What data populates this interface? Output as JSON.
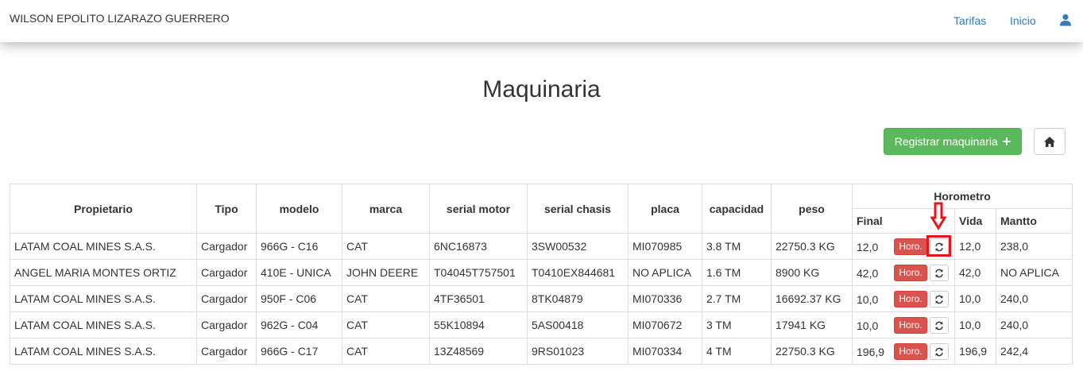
{
  "navbar": {
    "brand": "WILSON EPOLITO LIZARAZO GUERRERO",
    "links": [
      {
        "label": "Tarifas"
      },
      {
        "label": "Inicio"
      }
    ],
    "user_icon": "user-icon",
    "link_color": "#337ab7"
  },
  "page": {
    "title": "Maquinaria"
  },
  "toolbar": {
    "register_label": "Registrar maquinaria",
    "register_icon": "plus-icon",
    "home_icon": "home-icon",
    "register_color": "#5cb85c"
  },
  "table": {
    "headers": {
      "propietario": "Propietario",
      "tipo": "Tipo",
      "modelo": "modelo",
      "marca": "marca",
      "serial_motor": "serial motor",
      "serial_chasis": "serial chasis",
      "placa": "placa",
      "capacidad": "capacidad",
      "peso": "peso",
      "horometro": "Horometro",
      "final": "Final",
      "vida": "Vida",
      "mantto": "Mantto"
    },
    "horo_button_label": "Horo.",
    "horo_button_color": "#d9534f",
    "refresh_icon": "refresh-icon",
    "rows": [
      {
        "propietario": "LATAM COAL MINES S.A.S.",
        "tipo": "Cargador",
        "modelo": "966G - C16",
        "marca": "CAT",
        "serial_motor": "6NC16873",
        "serial_chasis": "3SW00532",
        "placa": "MI070985",
        "capacidad": "3.8 TM",
        "peso": "22750.3 KG",
        "final": "12,0",
        "vida": "12,0",
        "mantto": "238,0"
      },
      {
        "propietario": "ANGEL MARIA MONTES ORTIZ",
        "tipo": "Cargador",
        "modelo": "410E - UNICA",
        "marca": "JOHN DEERE",
        "serial_motor": "T04045T757501",
        "serial_chasis": "T0410EX844681",
        "placa": "NO APLICA",
        "capacidad": "1.6 TM",
        "peso": "8900 KG",
        "final": "42,0",
        "vida": "42,0",
        "mantto": "NO APLICA"
      },
      {
        "propietario": "LATAM COAL MINES S.A.S.",
        "tipo": "Cargador",
        "modelo": "950F - C06",
        "marca": "CAT",
        "serial_motor": "4TF36501",
        "serial_chasis": "8TK04879",
        "placa": "MI070336",
        "capacidad": "2.7 TM",
        "peso": "16692.37 KG",
        "final": "10,0",
        "vida": "10,0",
        "mantto": "240,0"
      },
      {
        "propietario": "LATAM COAL MINES S.A.S.",
        "tipo": "Cargador",
        "modelo": "962G - C04",
        "marca": "CAT",
        "serial_motor": "55K10894",
        "serial_chasis": "5AS00418",
        "placa": "MI070672",
        "capacidad": "3 TM",
        "peso": "17941 KG",
        "final": "10,0",
        "vida": "10,0",
        "mantto": "240,0"
      },
      {
        "propietario": "LATAM COAL MINES S.A.S.",
        "tipo": "Cargador",
        "modelo": "966G - C17",
        "marca": "CAT",
        "serial_motor": "13Z48569",
        "serial_chasis": "9RS01023",
        "placa": "MI070334",
        "capacidad": "4 TM",
        "peso": "22750.3 KG",
        "final": "196,9",
        "vida": "196,9",
        "mantto": "242,4"
      }
    ]
  },
  "annotation": {
    "highlight_color": "#e8161b",
    "arrow_icon": "arrow-down-icon"
  }
}
